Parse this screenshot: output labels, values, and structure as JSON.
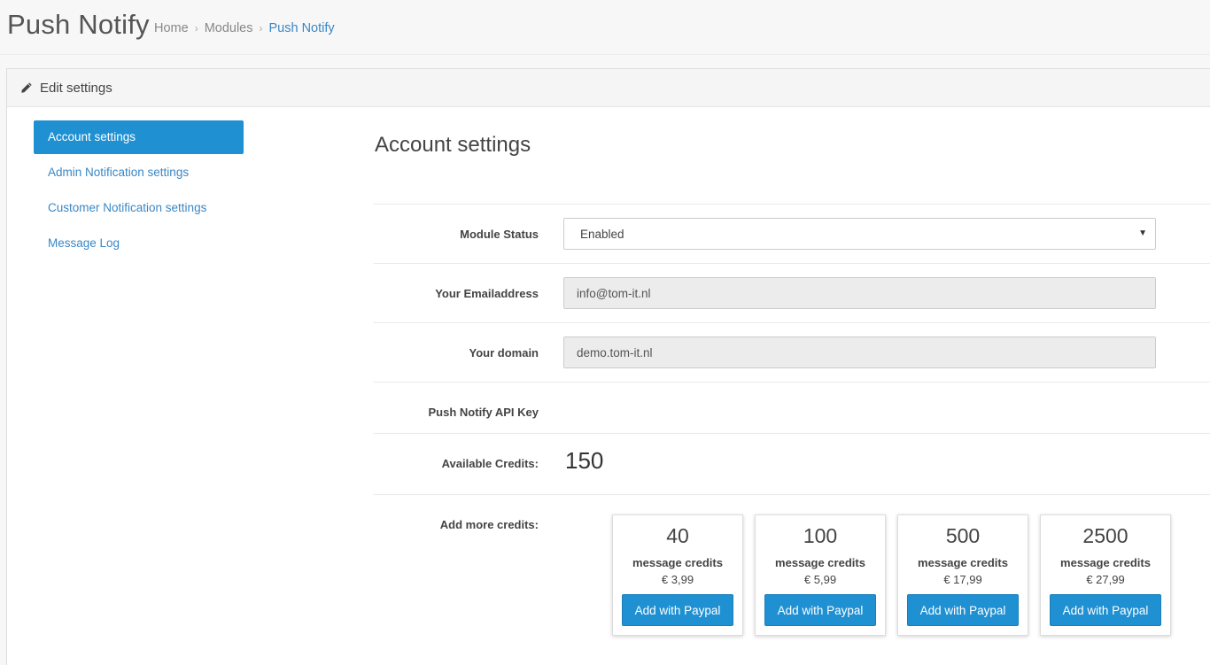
{
  "header": {
    "title": "Push Notify",
    "breadcrumb": [
      "Home",
      "Modules",
      "Push Notify"
    ],
    "separator": "›"
  },
  "panel": {
    "title": "Edit settings",
    "icon": "pencil-icon"
  },
  "sidebar": {
    "items": [
      {
        "label": "Account settings",
        "active": true
      },
      {
        "label": "Admin Notification settings",
        "active": false
      },
      {
        "label": "Customer Notification settings",
        "active": false
      },
      {
        "label": "Message Log",
        "active": false
      }
    ]
  },
  "form": {
    "section_title": "Account settings",
    "module_status": {
      "label": "Module Status",
      "value": "Enabled"
    },
    "email": {
      "label": "Your Emailaddress",
      "value": "info@tom-it.nl"
    },
    "domain": {
      "label": "Your domain",
      "value": "demo.tom-it.nl"
    },
    "api_key": {
      "label": "Push Notify API Key"
    },
    "credits": {
      "label": "Available Credits:",
      "value": "150"
    },
    "add_credits": {
      "label": "Add more credits:"
    }
  },
  "packages": [
    {
      "amount": "40",
      "unit": "message credits",
      "price": "€ 3,99",
      "button": "Add with Paypal"
    },
    {
      "amount": "100",
      "unit": "message credits",
      "price": "€ 5,99",
      "button": "Add with Paypal"
    },
    {
      "amount": "500",
      "unit": "message credits",
      "price": "€ 17,99",
      "button": "Add with Paypal"
    },
    {
      "amount": "2500",
      "unit": "message credits",
      "price": "€ 27,99",
      "button": "Add with Paypal"
    }
  ],
  "colors": {
    "accent": "#1f90d2",
    "link": "#3a87c5"
  }
}
